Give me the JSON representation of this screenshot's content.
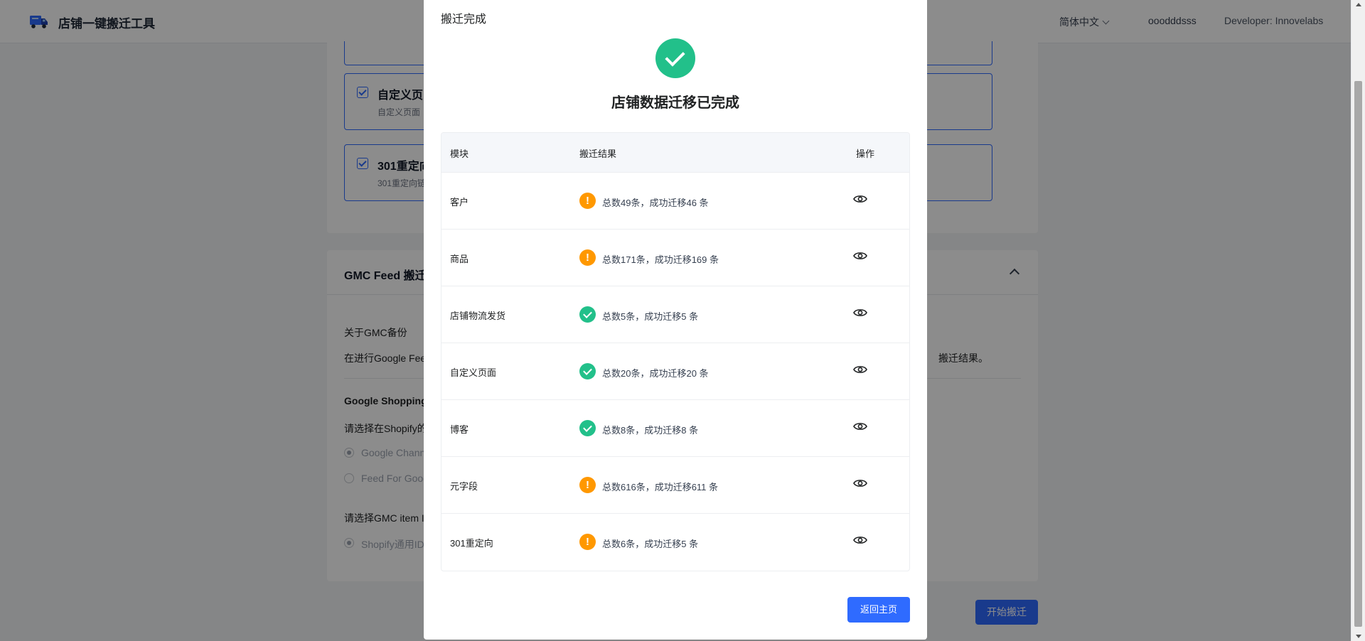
{
  "header": {
    "app_title": "店铺一键搬迁工具",
    "language": "简体中文",
    "username": "ooodddsss",
    "developer": "Developer: Innovelabs"
  },
  "background": {
    "modules": [
      {
        "title": "自定义页",
        "desc": "自定义页面"
      },
      {
        "title": "301重定向",
        "desc": "301重定向链"
      }
    ],
    "gmc": {
      "title": "GMC Feed 搬迁",
      "about": "关于GMC备份",
      "about_desc": "在进行Google Fee",
      "about_desc_tail": "搬迁结果。",
      "shopping_label": "Google Shopping",
      "choose_shopify": "请选择在Shopify的",
      "option_1": "Google Chann",
      "option_2": "Feed For Goog",
      "choose_gmc": "请选择GMC item I",
      "option_3": "Shopify通用ID"
    },
    "start_button": "开始搬迁"
  },
  "modal": {
    "title": "搬迁完成",
    "heading": "店铺数据迁移已完成",
    "columns": [
      "模块",
      "搬迁结果",
      "操作"
    ],
    "rows": [
      {
        "module": "客户",
        "status": "warning",
        "result": "总数49条，成功迁移46 条"
      },
      {
        "module": "商品",
        "status": "warning",
        "result": "总数171条，成功迁移169 条"
      },
      {
        "module": "店铺物流发货",
        "status": "success",
        "result": "总数5条，成功迁移5 条"
      },
      {
        "module": "自定义页面",
        "status": "success",
        "result": "总数20条，成功迁移20 条"
      },
      {
        "module": "博客",
        "status": "success",
        "result": "总数8条，成功迁移8 条"
      },
      {
        "module": "元字段",
        "status": "warning",
        "result": "总数616条，成功迁移611 条"
      },
      {
        "module": "301重定向",
        "status": "warning",
        "result": "总数6条，成功迁移5 条"
      }
    ],
    "home_button": "返回主页"
  },
  "colors": {
    "primary": "#2f6bff",
    "success": "#22c08a",
    "warning": "#ff9800"
  },
  "icons": {
    "success": "check-circle-icon",
    "warning": "exclamation-circle-icon",
    "view": "eye-icon"
  }
}
